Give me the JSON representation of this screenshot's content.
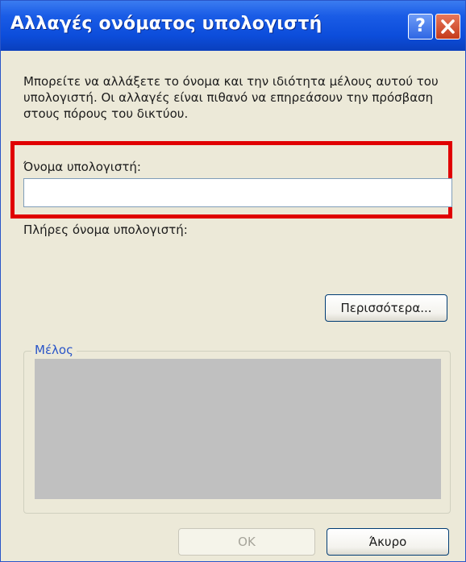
{
  "window": {
    "title": "Αλλαγές ονόματος υπολογιστή",
    "help_label": "?",
    "title_color": "#0c4ddb"
  },
  "dialog": {
    "description": "Μπορείτε να αλλάξετε το όνομα και την ιδιότητα μέλους αυτού του υπολογιστή. Οι αλλαγές είναι πιθανό να επηρεάσουν την πρόσβαση στους πόρους του δικτύου.",
    "computer_name_label": "Όνομα υπολογιστή:",
    "computer_name_value": "",
    "full_name_label": "Πλήρες όνομα υπολογιστή:",
    "more_button": "Περισσότερα...",
    "member_group_label": "Μέλος",
    "highlight_color": "#e00000"
  },
  "buttons": {
    "ok": "ΟΚ",
    "cancel": "Άκυρο"
  }
}
